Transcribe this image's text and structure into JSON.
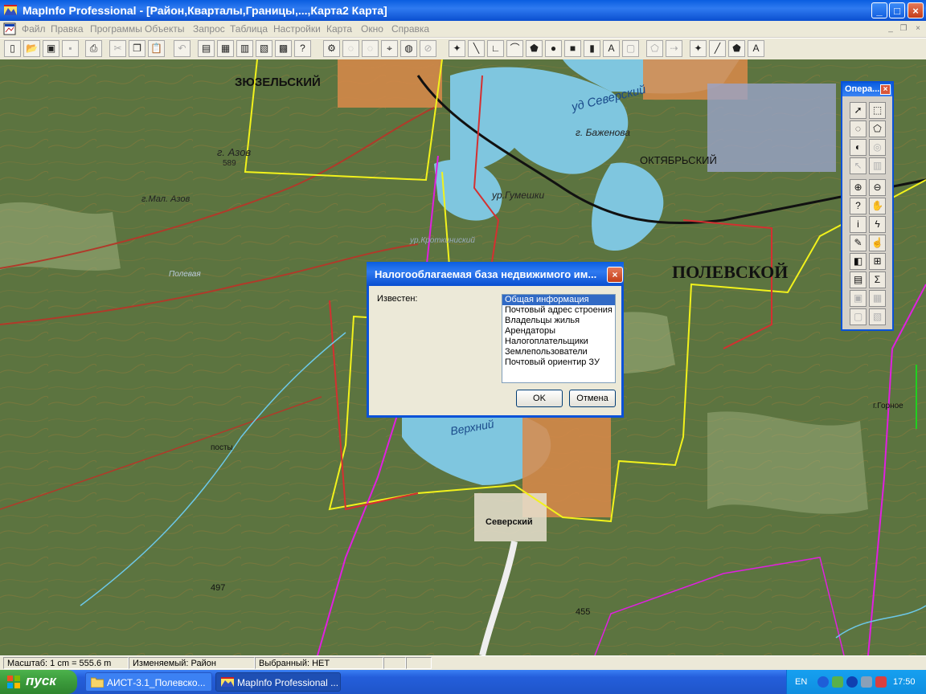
{
  "window": {
    "title": "MapInfo Professional - [Район,Кварталы,Границы,...,Карта2 Карта]",
    "minimize_label": "_",
    "maximize_label": "□",
    "close_label": "×"
  },
  "menubar": {
    "items": [
      "Файл",
      "Правка",
      "Программы",
      "Объекты",
      "Запрос",
      "Таблица",
      "Настройки",
      "Карта",
      "Окно",
      "Справка"
    ],
    "mdi_minimize": "_",
    "mdi_restore": "❐",
    "mdi_close": "×"
  },
  "toolbar": {
    "groups": [
      [
        "new-icon",
        "open-icon",
        "open-workspace-icon",
        "save-icon",
        "print-icon"
      ],
      [
        "cut-icon",
        "copy-icon",
        "paste-icon",
        "undo-icon"
      ],
      [
        "new-browser-icon",
        "new-mapper-icon",
        "new-grapher-icon",
        "new-layout-icon",
        "redistrict-icon",
        "help-pointer-icon"
      ],
      [
        "run-program-icon",
        "tool-icon-2",
        "tool-icon-3",
        "geocode-icon",
        "globe-icon",
        "tool-icon-6"
      ],
      [
        "symbol-icon",
        "line-icon",
        "polyline-icon",
        "arc-icon",
        "polygon-icon",
        "ellipse-icon",
        "rectangle-icon",
        "rounded-rect-icon",
        "text-icon",
        "frame-icon",
        "reshape-icon",
        "add-node-icon"
      ],
      [
        "symbol-style-icon",
        "line-style-icon",
        "region-style-icon",
        "text-style-icon"
      ]
    ]
  },
  "map": {
    "labels": {
      "zyuzelsky": "ЗЮЗЕЛЬСКИЙ",
      "azov": "г. Азов",
      "azov_height": "589",
      "mal_azov": "г.Мал. Азов",
      "severskiy": "уд Северский",
      "bazhenova": "г. Баженова",
      "oktyabrsky": "ОКТЯБРЬСКИЙ",
      "gumeshki": "ур.Гумешки",
      "krotovka": "ур.Кроткиниский",
      "polevskoy": "ПОЛЕВСКОЙ",
      "polevaya": "Полевая",
      "verkhny": "Верхний",
      "severskiy_town": "Северский",
      "posty": "посты",
      "h497": "497",
      "h455": "455",
      "gornoe": "г.Горное"
    }
  },
  "palette": {
    "title": "Опера...",
    "close_label": "×"
  },
  "dialog": {
    "title": "Налогооблагаемая база  недвижимого им...",
    "close_label": "×",
    "label": "Известен:",
    "items": [
      "Общая информация",
      "Почтовый адрес строения",
      "Владельцы жилья",
      "Арендаторы",
      "Налогоплательщики",
      "Землепользователи",
      "Почтовый ориентир ЗУ"
    ],
    "selected_index": 0,
    "ok_label": "OK",
    "cancel_label": "Отмена"
  },
  "statusbar": {
    "scale": "Масштаб: 1 cm = 555.6 m",
    "editable": "Изменяемый: Район",
    "selected": "Выбранный: НЕТ"
  },
  "taskbar": {
    "start_label": "пуск",
    "tasks": [
      "АИСТ-3.1_Полевско...",
      "MapInfo Professional ..."
    ],
    "language": "EN",
    "clock": "17:50"
  },
  "colors": {
    "xp_blue": "#0a5ee0",
    "map_green": "#5c7440",
    "water": "#7fc6df",
    "boundary_yellow": "#f2f21c",
    "boundary_magenta": "#e020e0",
    "boundary_red": "#d43030"
  }
}
